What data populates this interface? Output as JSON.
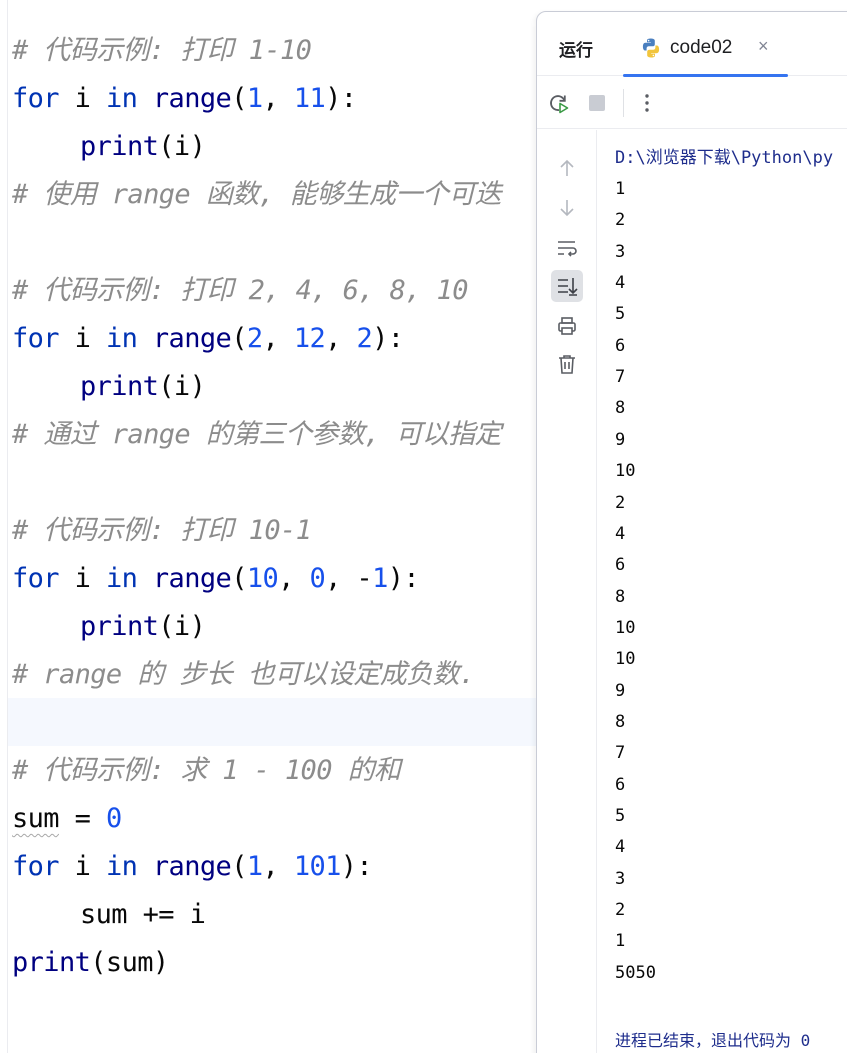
{
  "editor": {
    "lines": [
      {
        "kind": "comment",
        "text": "# 代码示例: 打印 1-10"
      },
      {
        "kind": "code",
        "tokens": [
          [
            "kw",
            "for"
          ],
          [
            "plain",
            " i "
          ],
          [
            "kw",
            "in"
          ],
          [
            "plain",
            " "
          ],
          [
            "fn",
            "range"
          ],
          [
            "plain",
            "("
          ],
          [
            "num",
            "1"
          ],
          [
            "plain",
            ", "
          ],
          [
            "num",
            "11"
          ],
          [
            "plain",
            "):"
          ]
        ]
      },
      {
        "kind": "code",
        "indent": true,
        "tokens": [
          [
            "fn",
            "print"
          ],
          [
            "plain",
            "(i)"
          ]
        ]
      },
      {
        "kind": "comment",
        "text": "# 使用 range 函数, 能够生成一个可迭"
      },
      {
        "kind": "blank"
      },
      {
        "kind": "comment",
        "text": "# 代码示例: 打印 2, 4, 6, 8, 10"
      },
      {
        "kind": "code",
        "tokens": [
          [
            "kw",
            "for"
          ],
          [
            "plain",
            " i "
          ],
          [
            "kw",
            "in"
          ],
          [
            "plain",
            " "
          ],
          [
            "fn",
            "range"
          ],
          [
            "plain",
            "("
          ],
          [
            "num",
            "2"
          ],
          [
            "plain",
            ", "
          ],
          [
            "num",
            "12"
          ],
          [
            "plain",
            ", "
          ],
          [
            "num",
            "2"
          ],
          [
            "plain",
            "):"
          ]
        ]
      },
      {
        "kind": "code",
        "indent": true,
        "tokens": [
          [
            "fn",
            "print"
          ],
          [
            "plain",
            "(i)"
          ]
        ]
      },
      {
        "kind": "comment",
        "text": "# 通过 range 的第三个参数, 可以指定"
      },
      {
        "kind": "blank"
      },
      {
        "kind": "comment",
        "text": "# 代码示例: 打印 10-1"
      },
      {
        "kind": "code",
        "tokens": [
          [
            "kw",
            "for"
          ],
          [
            "plain",
            " i "
          ],
          [
            "kw",
            "in"
          ],
          [
            "plain",
            " "
          ],
          [
            "fn",
            "range"
          ],
          [
            "plain",
            "("
          ],
          [
            "num",
            "10"
          ],
          [
            "plain",
            ", "
          ],
          [
            "num",
            "0"
          ],
          [
            "plain",
            ", -"
          ],
          [
            "num",
            "1"
          ],
          [
            "plain",
            "):"
          ]
        ]
      },
      {
        "kind": "code",
        "indent": true,
        "tokens": [
          [
            "fn",
            "print"
          ],
          [
            "plain",
            "(i)"
          ]
        ]
      },
      {
        "kind": "comment",
        "text": "# range 的 步长 也可以设定成负数."
      },
      {
        "kind": "blank"
      },
      {
        "kind": "comment",
        "text": "# 代码示例: 求 1 - 100 的和"
      },
      {
        "kind": "code",
        "tokens": [
          [
            "squiggle",
            "sum"
          ],
          [
            "plain",
            " = "
          ],
          [
            "num",
            "0"
          ]
        ]
      },
      {
        "kind": "code",
        "tokens": [
          [
            "kw",
            "for"
          ],
          [
            "plain",
            " i "
          ],
          [
            "kw",
            "in"
          ],
          [
            "plain",
            " "
          ],
          [
            "fn",
            "range"
          ],
          [
            "plain",
            "("
          ],
          [
            "num",
            "1"
          ],
          [
            "plain",
            ", "
          ],
          [
            "num",
            "101"
          ],
          [
            "plain",
            "):"
          ]
        ]
      },
      {
        "kind": "code",
        "indent": true,
        "tokens": [
          [
            "plain",
            "sum += i"
          ]
        ]
      },
      {
        "kind": "code",
        "tokens": [
          [
            "fn",
            "print"
          ],
          [
            "plain",
            "(sum)"
          ]
        ]
      }
    ]
  },
  "run_panel": {
    "title": "运行",
    "tab_label": "code02",
    "tab_close": "×",
    "toolbar": {
      "rerun_icon": "rerun-icon",
      "stop_icon": "stop-icon",
      "more_icon": "more-vertical-icon"
    },
    "side_icons": [
      "arrow-up-icon",
      "arrow-down-icon",
      "soft-wrap-icon",
      "scroll-to-end-icon",
      "print-icon",
      "trash-icon"
    ],
    "console": {
      "path": "D:\\浏览器下载\\Python\\py",
      "output": [
        "1",
        "2",
        "3",
        "4",
        "5",
        "6",
        "7",
        "8",
        "9",
        "10",
        "2",
        "4",
        "6",
        "8",
        "10",
        "10",
        "9",
        "8",
        "7",
        "6",
        "5",
        "4",
        "3",
        "2",
        "1",
        "5050"
      ],
      "exit_message": "进程已结束，退出代码为 0"
    }
  },
  "colors": {
    "keyword": "#0033b3",
    "function": "#000080",
    "number": "#1750eb",
    "comment": "#8c8c8c",
    "tab_accent": "#3574f0"
  }
}
